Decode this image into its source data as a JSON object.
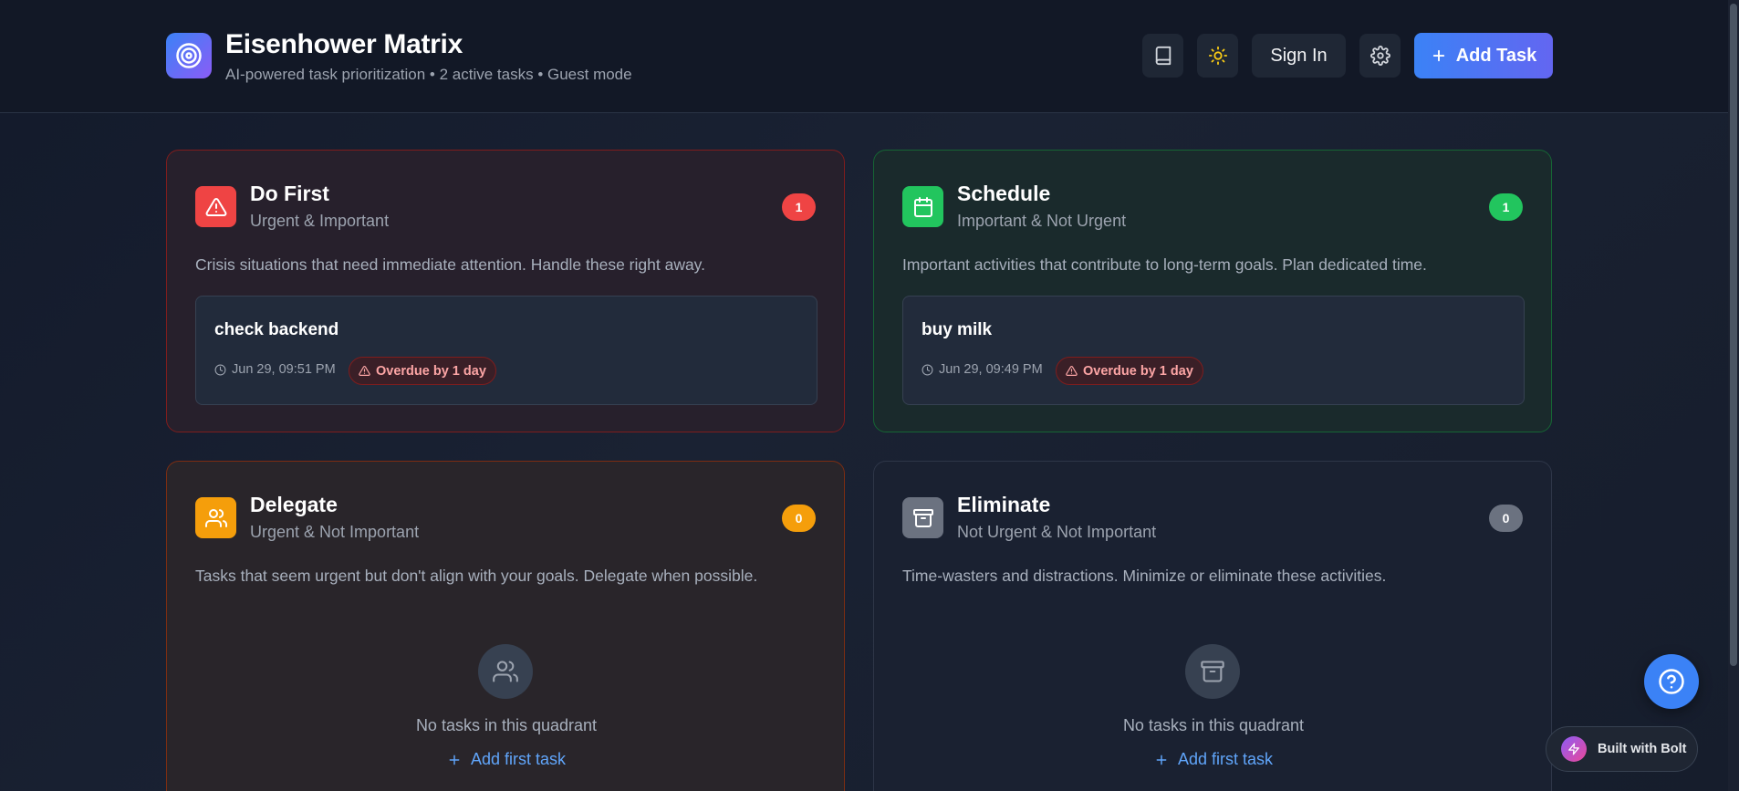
{
  "header": {
    "title": "Eisenhower Matrix",
    "subtitle": "AI-powered task prioritization • 2 active tasks  • Guest mode",
    "sign_in_label": "Sign In",
    "add_task_label": "Add Task"
  },
  "quadrants": [
    {
      "title": "Do First",
      "subtitle": "Urgent & Important",
      "count": "1",
      "description": "Crisis situations that need immediate attention. Handle these right away.",
      "accent": "#ef4444",
      "icon": "alert-triangle-icon",
      "task": {
        "title": "check backend",
        "date": "Jun 29, 09:51 PM",
        "overdue": "Overdue by 1 day"
      }
    },
    {
      "title": "Schedule",
      "subtitle": "Important & Not Urgent",
      "count": "1",
      "description": "Important activities that contribute to long-term goals. Plan dedicated time.",
      "accent": "#22c55e",
      "icon": "calendar-icon",
      "task": {
        "title": "buy milk",
        "date": "Jun 29, 09:49 PM",
        "overdue": "Overdue by 1 day"
      }
    },
    {
      "title": "Delegate",
      "subtitle": "Urgent & Not Important",
      "count": "0",
      "description": "Tasks that seem urgent but don't align with your goals. Delegate when possible.",
      "accent": "#f59e0b",
      "icon": "users-icon",
      "empty_text": "No tasks in this quadrant",
      "add_first_label": "Add first task"
    },
    {
      "title": "Eliminate",
      "subtitle": "Not Urgent & Not Important",
      "count": "0",
      "description": "Time-wasters and distractions. Minimize or eliminate these activities.",
      "accent": "#6b7280",
      "icon": "archive-icon",
      "empty_text": "No tasks in this quadrant",
      "add_first_label": "Add first task"
    }
  ],
  "footer": {
    "built_with": "Built with Bolt"
  }
}
